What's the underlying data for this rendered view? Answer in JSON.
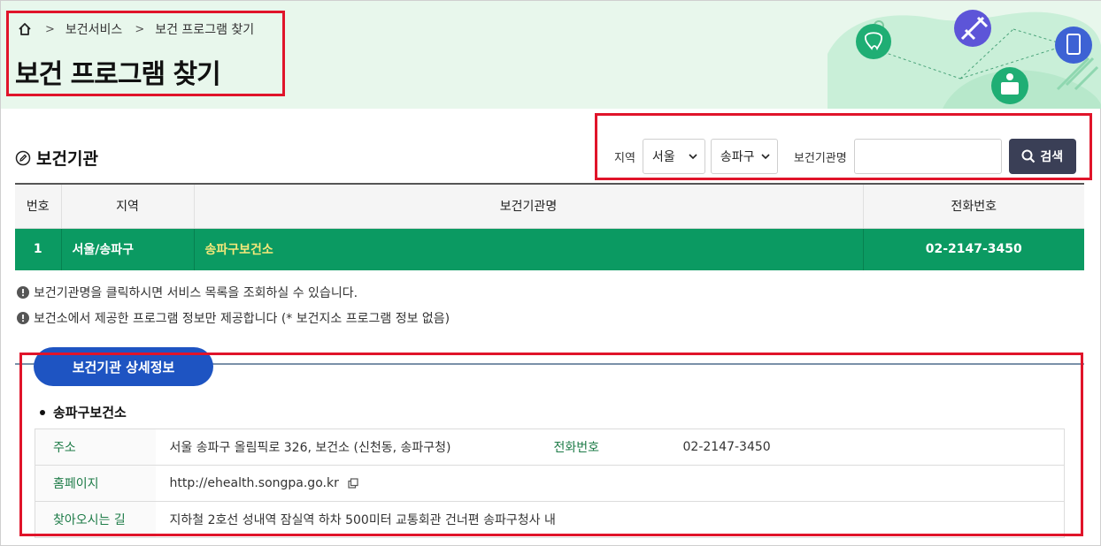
{
  "breadcrumb": {
    "home_icon": "home-icon",
    "items": [
      "보건서비스",
      "보건 프로그램 찾기"
    ]
  },
  "page_title": "보건 프로그램 찾기",
  "section": {
    "title": "보건기관",
    "icon": "edit-circle-icon"
  },
  "search": {
    "region_label": "지역",
    "city_value": "서울",
    "district_value": "송파구",
    "org_label": "보건기관명",
    "org_value": "",
    "button_label": "검색",
    "button_icon": "search-icon"
  },
  "results_table": {
    "headers": [
      "번호",
      "지역",
      "보건기관명",
      "전화번호"
    ],
    "rows": [
      {
        "no": "1",
        "region": "서울/송파구",
        "name": "송파구보건소",
        "phone": "02-2147-3450"
      }
    ]
  },
  "notes": [
    "보건기관명을 클릭하시면 서비스 목록을 조회하실 수 있습니다.",
    "보건소에서 제공한 프로그램 정보만 제공합니다 (* 보건지소 프로그램 정보 없음)"
  ],
  "detail": {
    "tab_label": "보건기관 상세정보",
    "org_name": "송파구보건소",
    "address_label": "주소",
    "address_value": "서울 송파구 올림픽로 326, 보건소 (신천동, 송파구청)",
    "phone_label": "전화번호",
    "phone_value": "02-2147-3450",
    "homepage_label": "홈페이지",
    "homepage_value": "http://ehealth.songpa.go.kr",
    "directions_label": "찾아오시는 길",
    "directions_value": "지하철 2호선 성내역 잠실역 하차 500미터 교통회관 건너편 송파구청사 내"
  },
  "colors": {
    "hero_bg": "#e8f7ec",
    "row_green": "#0b9a62",
    "org_link_yellow": "#f5e87a",
    "button_dark": "#3a3f56",
    "pill_blue": "#1e54c2",
    "highlight_red": "#e0142a",
    "label_green": "#1d7b47"
  }
}
